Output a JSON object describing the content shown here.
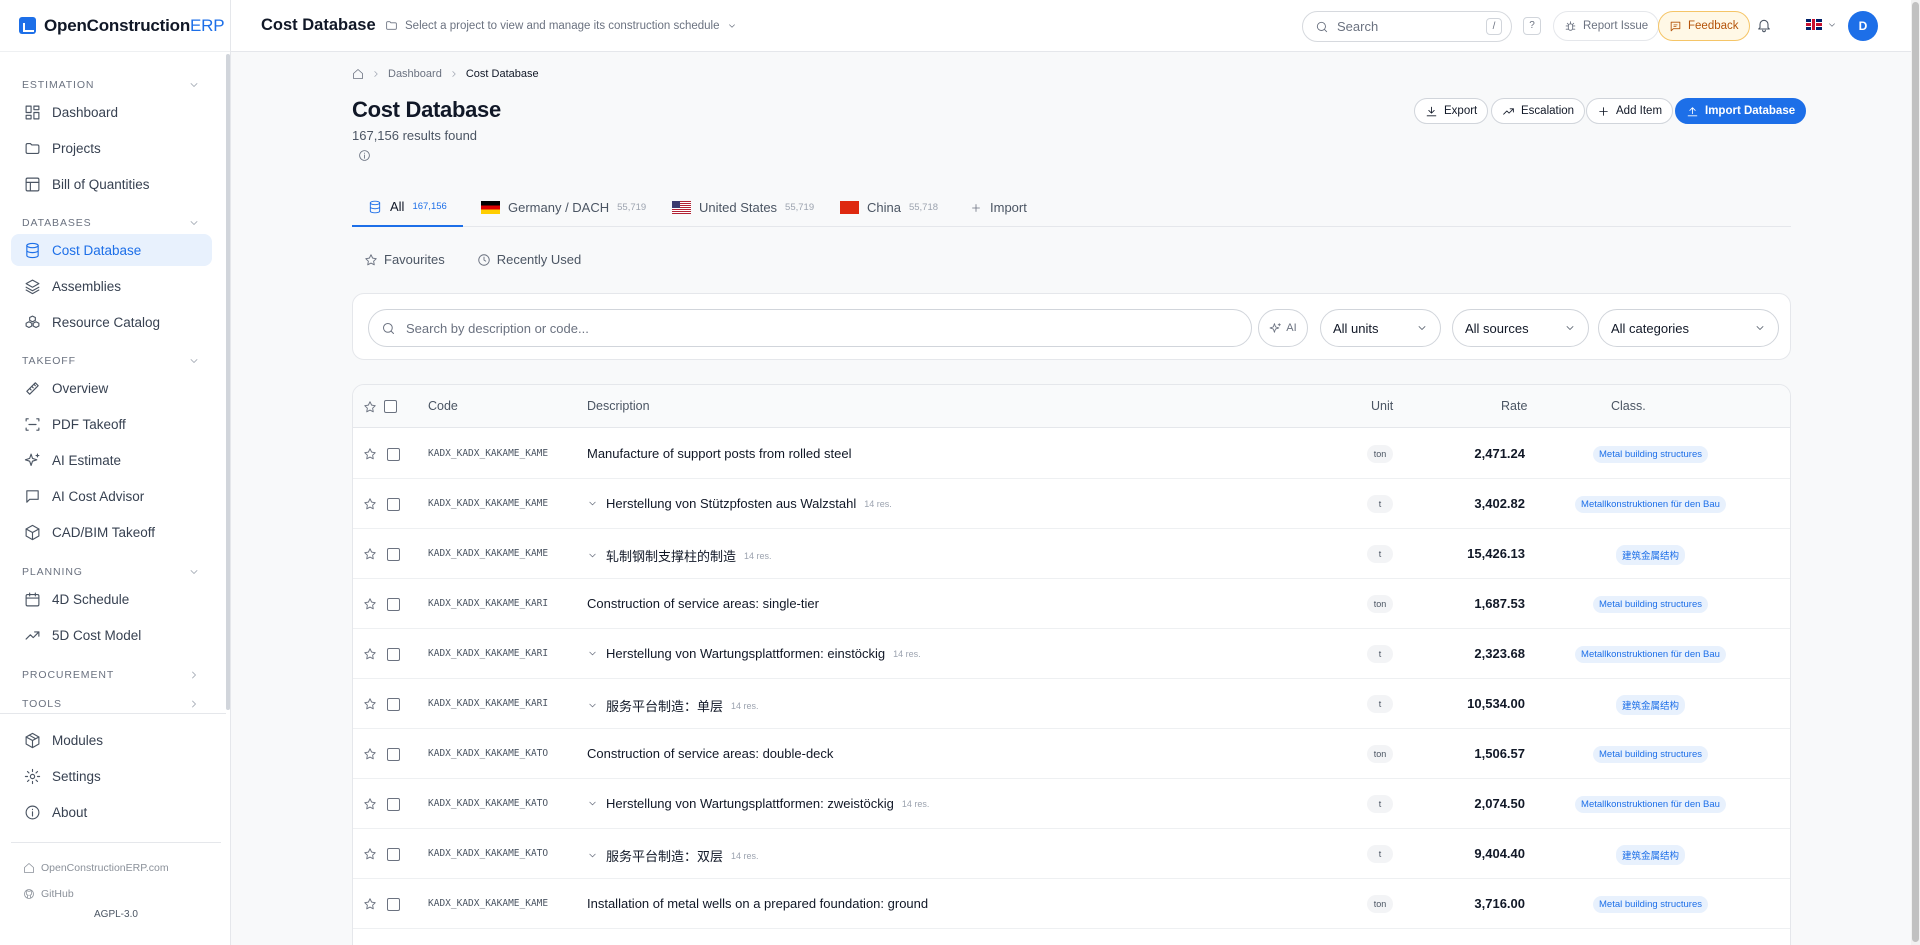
{
  "brand": {
    "name_main": "OpenConstruction",
    "name_accent": "ERP"
  },
  "sidebar": {
    "sections": [
      {
        "label": "ESTIMATION",
        "items": [
          {
            "label": "Dashboard",
            "icon": "dashboard-icon"
          },
          {
            "label": "Projects",
            "icon": "folder-icon"
          },
          {
            "label": "Bill of Quantities",
            "icon": "table-icon"
          }
        ]
      },
      {
        "label": "DATABASES",
        "items": [
          {
            "label": "Cost Database",
            "icon": "database-icon",
            "active": true
          },
          {
            "label": "Assemblies",
            "icon": "layers-icon"
          },
          {
            "label": "Resource Catalog",
            "icon": "boxes-icon"
          }
        ]
      },
      {
        "label": "TAKEOFF",
        "items": [
          {
            "label": "Overview",
            "icon": "ruler-icon"
          },
          {
            "label": "PDF Takeoff",
            "icon": "scan-icon"
          },
          {
            "label": "AI Estimate",
            "icon": "sparkles-icon"
          },
          {
            "label": "AI Cost Advisor",
            "icon": "chat-icon"
          },
          {
            "label": "CAD/BIM Takeoff",
            "icon": "cube-icon"
          }
        ]
      },
      {
        "label": "PLANNING",
        "items": [
          {
            "label": "4D Schedule",
            "icon": "calendar-icon"
          },
          {
            "label": "5D Cost Model",
            "icon": "trend-icon"
          }
        ]
      },
      {
        "label": "PROCUREMENT",
        "items": []
      },
      {
        "label": "TOOLS",
        "items": []
      }
    ],
    "bottom": [
      {
        "label": "Modules",
        "icon": "package-icon"
      },
      {
        "label": "Settings",
        "icon": "gear-icon"
      },
      {
        "label": "About",
        "icon": "info-icon"
      }
    ],
    "footer_links": [
      {
        "label": "OpenConstructionERP.com",
        "icon": "home-icon"
      },
      {
        "label": "GitHub",
        "icon": "github-icon"
      }
    ],
    "license": "AGPL-3.0"
  },
  "topbar": {
    "title": "Cost Database",
    "project_hint": "Select a project to view and manage its construction schedule",
    "search_placeholder": "Search",
    "search_kbd": "/",
    "help": "?",
    "report": "Report Issue",
    "feedback": "Feedback",
    "avatar": "D"
  },
  "breadcrumb": {
    "items": [
      "Dashboard",
      "Cost Database"
    ]
  },
  "page": {
    "title": "Cost Database",
    "results": "167,156 results found",
    "actions": {
      "export": "Export",
      "escalation": "Escalation",
      "add_item": "Add Item",
      "import_db": "Import Database"
    }
  },
  "tabs": [
    {
      "label": "All",
      "count": "167,156",
      "active": true
    },
    {
      "label": "Germany / DACH",
      "count": "55,719"
    },
    {
      "label": "United States",
      "count": "55,719"
    },
    {
      "label": "China",
      "count": "55,718"
    },
    {
      "label": "Import",
      "count": ""
    }
  ],
  "subtabs": [
    {
      "label": "Favourites",
      "icon": "star-icon"
    },
    {
      "label": "Recently Used",
      "icon": "clock-icon"
    }
  ],
  "filters": {
    "search_placeholder": "Search by description or code...",
    "ai_label": "AI",
    "units": "All units",
    "sources": "All sources",
    "categories": "All categories"
  },
  "table": {
    "headers": {
      "code": "Code",
      "description": "Description",
      "unit": "Unit",
      "rate": "Rate",
      "class": "Class."
    },
    "rows": [
      {
        "code": "KADX_KADX_KAKAME_KAME",
        "description": "Manufacture of support posts from rolled steel",
        "res": "",
        "expandable": false,
        "unit": "ton",
        "rate": "2,471.24",
        "class": "Metal building structures"
      },
      {
        "code": "KADX_KADX_KAKAME_KAME",
        "description": "Herstellung von Stützpfosten aus Walzstahl",
        "res": "14 res.",
        "expandable": true,
        "unit": "t",
        "rate": "3,402.82",
        "class": "Metallkonstruktionen für den Bau"
      },
      {
        "code": "KADX_KADX_KAKAME_KAME",
        "description": "轧制钢制支撑柱的制造",
        "res": "14 res.",
        "expandable": true,
        "unit": "t",
        "rate": "15,426.13",
        "class": "建筑金属结构"
      },
      {
        "code": "KADX_KADX_KAKAME_KARI",
        "description": "Construction of service areas: single-tier",
        "res": "",
        "expandable": false,
        "unit": "ton",
        "rate": "1,687.53",
        "class": "Metal building structures"
      },
      {
        "code": "KADX_KADX_KAKAME_KARI",
        "description": "Herstellung von Wartungsplattformen: einstöckig",
        "res": "14 res.",
        "expandable": true,
        "unit": "t",
        "rate": "2,323.68",
        "class": "Metallkonstruktionen für den Bau"
      },
      {
        "code": "KADX_KADX_KAKAME_KARI",
        "description": "服务平台制造：单层",
        "res": "14 res.",
        "expandable": true,
        "unit": "t",
        "rate": "10,534.00",
        "class": "建筑金属结构"
      },
      {
        "code": "KADX_KADX_KAKAME_KATO",
        "description": "Construction of service areas: double-deck",
        "res": "",
        "expandable": false,
        "unit": "ton",
        "rate": "1,506.57",
        "class": "Metal building structures"
      },
      {
        "code": "KADX_KADX_KAKAME_KATO",
        "description": "Herstellung von Wartungsplattformen: zweistöckig",
        "res": "14 res.",
        "expandable": true,
        "unit": "t",
        "rate": "2,074.50",
        "class": "Metallkonstruktionen für den Bau"
      },
      {
        "code": "KADX_KADX_KAKAME_KATO",
        "description": "服务平台制造：双层",
        "res": "14 res.",
        "expandable": true,
        "unit": "t",
        "rate": "9,404.40",
        "class": "建筑金属结构"
      },
      {
        "code": "KADX_KADX_KAKAME_KAME",
        "description": "Installation of metal wells on a prepared foundation: ground",
        "res": "",
        "expandable": false,
        "unit": "ton",
        "rate": "3,716.00",
        "class": "Metal building structures"
      }
    ]
  }
}
